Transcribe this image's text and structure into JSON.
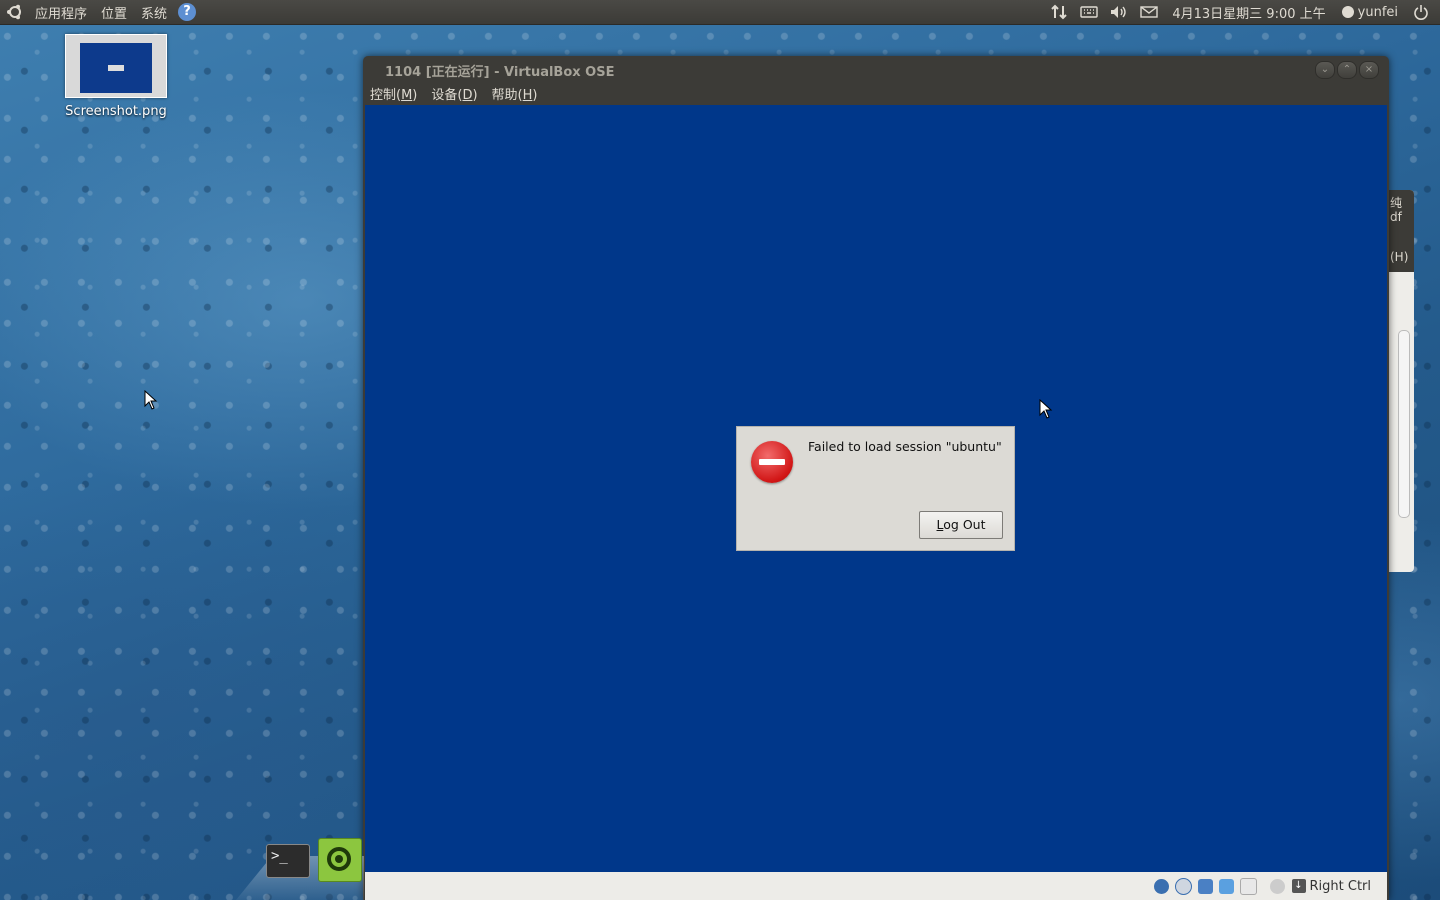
{
  "top_panel": {
    "menus": [
      "应用程序",
      "位置",
      "系统"
    ],
    "clock": "4月13日星期三  9:00 上午",
    "user": "yunfei",
    "tray_icons": [
      "network-icon",
      "keyboard-icon",
      "volume-icon",
      "mail-icon"
    ]
  },
  "desktop": {
    "icon_label": "Screenshot.png"
  },
  "vbox": {
    "title": "1104 [正在运行] - VirtualBox OSE",
    "menus": [
      {
        "label": "控制(",
        "key": "M",
        "end": ")"
      },
      {
        "label": "设备(",
        "key": "D",
        "end": ")"
      },
      {
        "label": "帮助(",
        "key": "H",
        "end": ")"
      }
    ],
    "host_key": "Right Ctrl"
  },
  "dialog": {
    "message": "Failed to load session \"ubuntu\"",
    "button_key": "L",
    "button_rest": "og Out"
  },
  "bg_window": {
    "text1": "纯",
    "text2": "df",
    "text3": "(H)"
  },
  "colors": {
    "vm_screen": "#00378a",
    "panel": "#3c3b37",
    "error": "#d11515"
  }
}
